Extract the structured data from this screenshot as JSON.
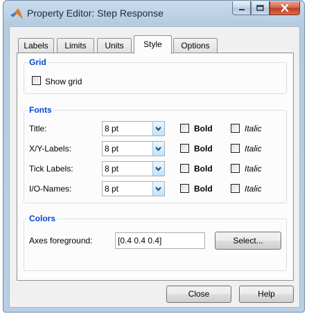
{
  "window": {
    "title": "Property Editor: Step Response",
    "caption_buttons": [
      "minimize-icon",
      "maximize-icon",
      "close-icon"
    ]
  },
  "tabs": [
    {
      "label": "Labels",
      "active": false
    },
    {
      "label": "Limits",
      "active": false
    },
    {
      "label": "Units",
      "active": false
    },
    {
      "label": "Style",
      "active": true
    },
    {
      "label": "Options",
      "active": false
    }
  ],
  "grid": {
    "title": "Grid",
    "show_grid_label": "Show grid",
    "show_grid_checked": false
  },
  "fonts": {
    "title": "Fonts",
    "bold_label": "Bold",
    "italic_label": "Italic",
    "rows": [
      {
        "label": "Title:",
        "size": "8 pt",
        "bold": false,
        "italic": false
      },
      {
        "label": "X/Y-Labels:",
        "size": "8 pt",
        "bold": false,
        "italic": false
      },
      {
        "label": "Tick Labels:",
        "size": "8 pt",
        "bold": false,
        "italic": false
      },
      {
        "label": "I/O-Names:",
        "size": "8 pt",
        "bold": false,
        "italic": false
      }
    ]
  },
  "colors": {
    "title": "Colors",
    "axes_foreground_label": "Axes foreground:",
    "axes_foreground_value": "[0.4 0.4 0.4]",
    "select_label": "Select..."
  },
  "footer": {
    "close_label": "Close",
    "help_label": "Help"
  }
}
